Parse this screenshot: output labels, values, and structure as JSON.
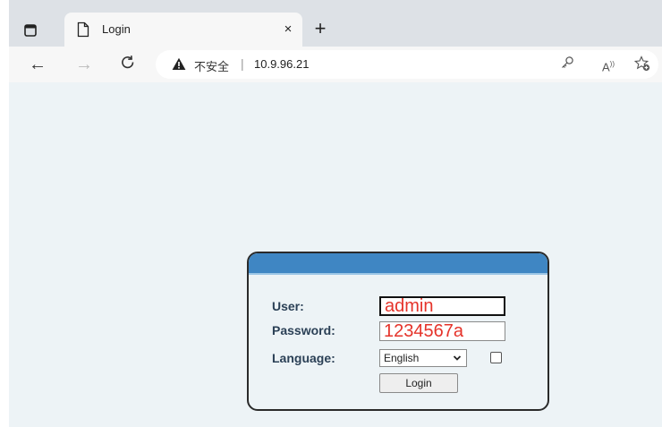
{
  "browser": {
    "tab": {
      "title": "Login",
      "close": "×"
    },
    "new_tab": "+",
    "security_text": "不安全",
    "url": "10.9.96.21"
  },
  "login": {
    "user_label": "User:",
    "password_label": "Password:",
    "language_label": "Language:",
    "user_value": "admin",
    "password_value": "1234567a",
    "language_selected": "English",
    "login_button": "Login",
    "remember_checked": false
  },
  "colors": {
    "header_blue": "#3f86c3",
    "label_color": "#2b4056",
    "input_text": "#e5332a",
    "page_bg": "#edf3f6"
  },
  "icons": [
    "tab-actions-icon",
    "page-icon",
    "close-icon",
    "plus-icon",
    "back-arrow-icon",
    "forward-arrow-icon",
    "refresh-icon",
    "warning-icon",
    "key-icon",
    "read-aloud-icon",
    "favorite-add-icon",
    "chevron-down-icon"
  ]
}
